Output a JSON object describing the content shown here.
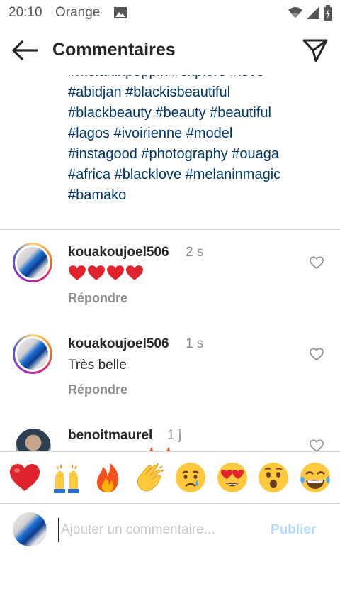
{
  "status_bar": {
    "time": "20:10",
    "carrier": "Orange"
  },
  "header": {
    "title": "Commentaires"
  },
  "caption": {
    "lines": [
      "#melaninpoppin #explore #love",
      "#abidjan #blackisbeautiful",
      "#blackbeauty #beauty #beautiful",
      "#lagos #ivoirienne #model",
      "#instagood #photography #ouaga",
      "#africa #blacklove #melaninmagic",
      "#bamako"
    ]
  },
  "comments": [
    {
      "username": "kouakoujoel506",
      "time": "2 s",
      "text": "",
      "hearts": 4,
      "reply": "Répondre"
    },
    {
      "username": "kouakoujoel506",
      "time": "1 s",
      "text": "Très belle",
      "reply": "Répondre"
    },
    {
      "username": "benoitmaurel",
      "time": "1 j"
    }
  ],
  "emoji_bar": {
    "items": [
      "red-heart",
      "raising-hands",
      "fire",
      "clapping-hands",
      "crying-face",
      "heart-eyes-face",
      "surprised-face",
      "tears-of-joy-face"
    ]
  },
  "composer": {
    "placeholder": "Ajouter un commentaire...",
    "publish_label": "Publier"
  },
  "colors": {
    "hashtag": "#00376b",
    "publish_disabled": "#b3dbff",
    "muted": "#8e8e8e"
  }
}
